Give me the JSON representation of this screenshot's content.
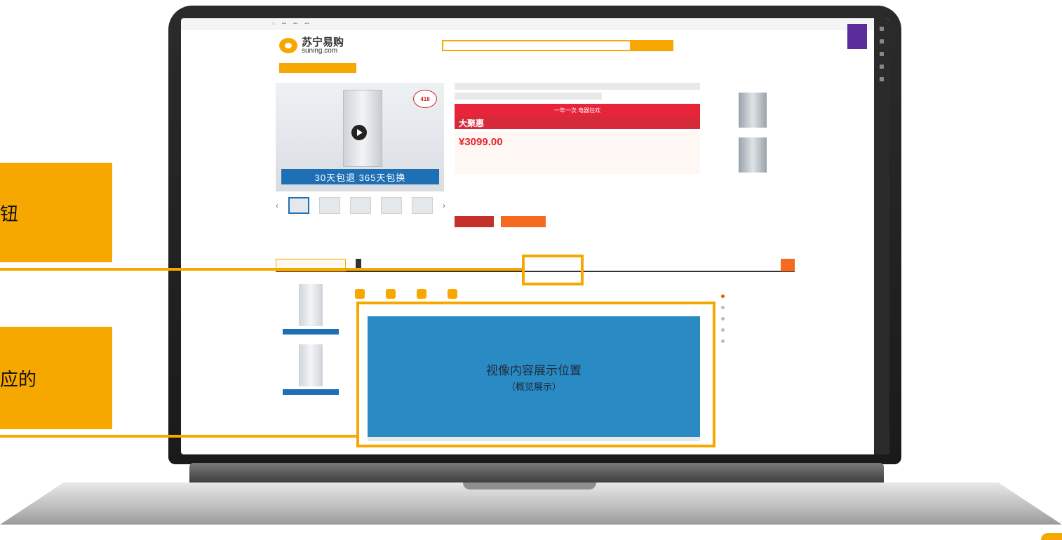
{
  "callouts": [
    {
      "text": "钮"
    },
    {
      "text": "应的"
    }
  ],
  "page": {
    "logo": {
      "cn": "苏宁易购",
      "en": "suning.com"
    },
    "gallery_banner": "30天包退 365天包换",
    "badge_418": "418",
    "price": "¥3099.00",
    "big_banner": "一年一次 电器狂欢",
    "dajuhui": "大聚惠",
    "video_area": {
      "title": "视像内容展示位置",
      "subtitle": "（概览展示）"
    }
  },
  "colors": {
    "accent": "#f7a800",
    "video_bg": "#2a8ac4",
    "price_red": "#e3262c"
  }
}
